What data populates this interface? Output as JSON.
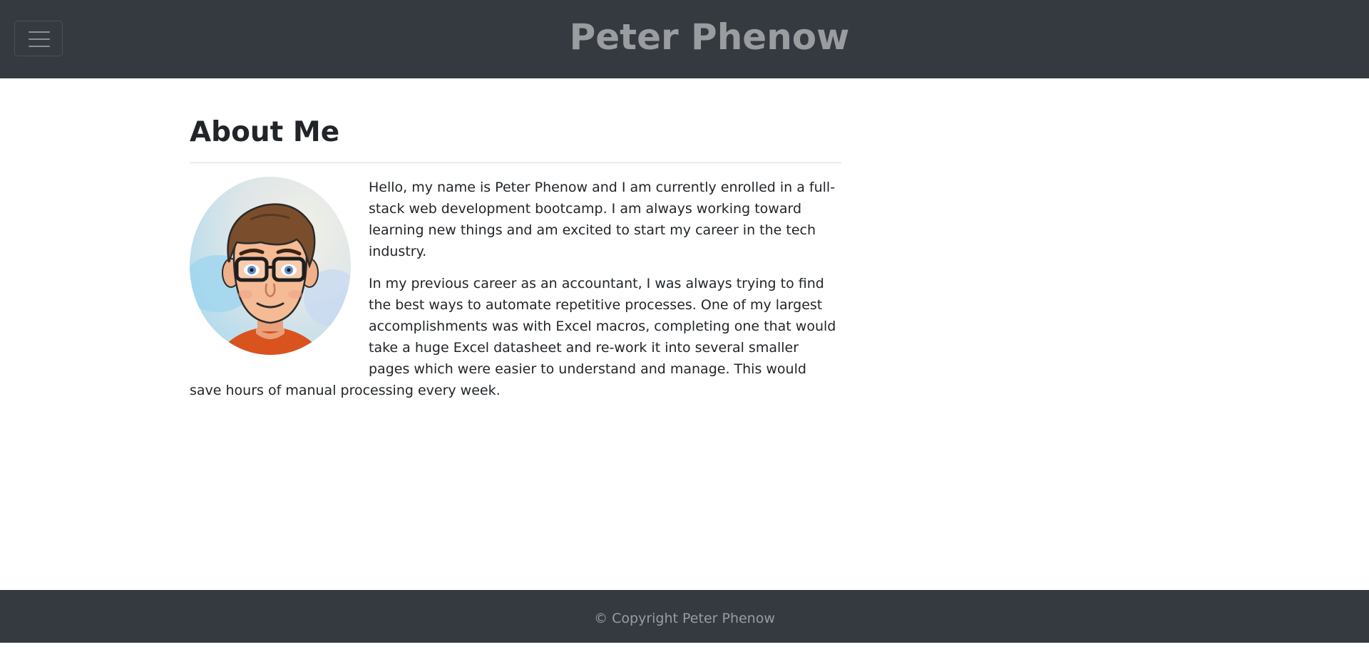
{
  "header": {
    "brand": "Peter Phenow",
    "menu_icon": "hamburger-icon"
  },
  "about": {
    "title": "About Me",
    "avatar_alt": "cartoon avatar",
    "paragraphs": [
      "Hello, my name is Peter Phenow and I am currently enrolled in a full-stack web development bootcamp. I am always working toward learning new things and am excited to start my career in the tech industry.",
      "In my previous career as an accountant, I was always trying to find the best ways to automate repetitive processes. One of my largest accomplishments was with Excel macros, completing one that would take a huge Excel datasheet and re-work it into several smaller pages which were easier to understand and manage. This would save hours of manual processing every week."
    ]
  },
  "footer": {
    "copyright": "© Copyright Peter Phenow"
  },
  "colors": {
    "navbar": "#343a40",
    "brand_text": "#9a9da0",
    "body_text": "#212529"
  }
}
